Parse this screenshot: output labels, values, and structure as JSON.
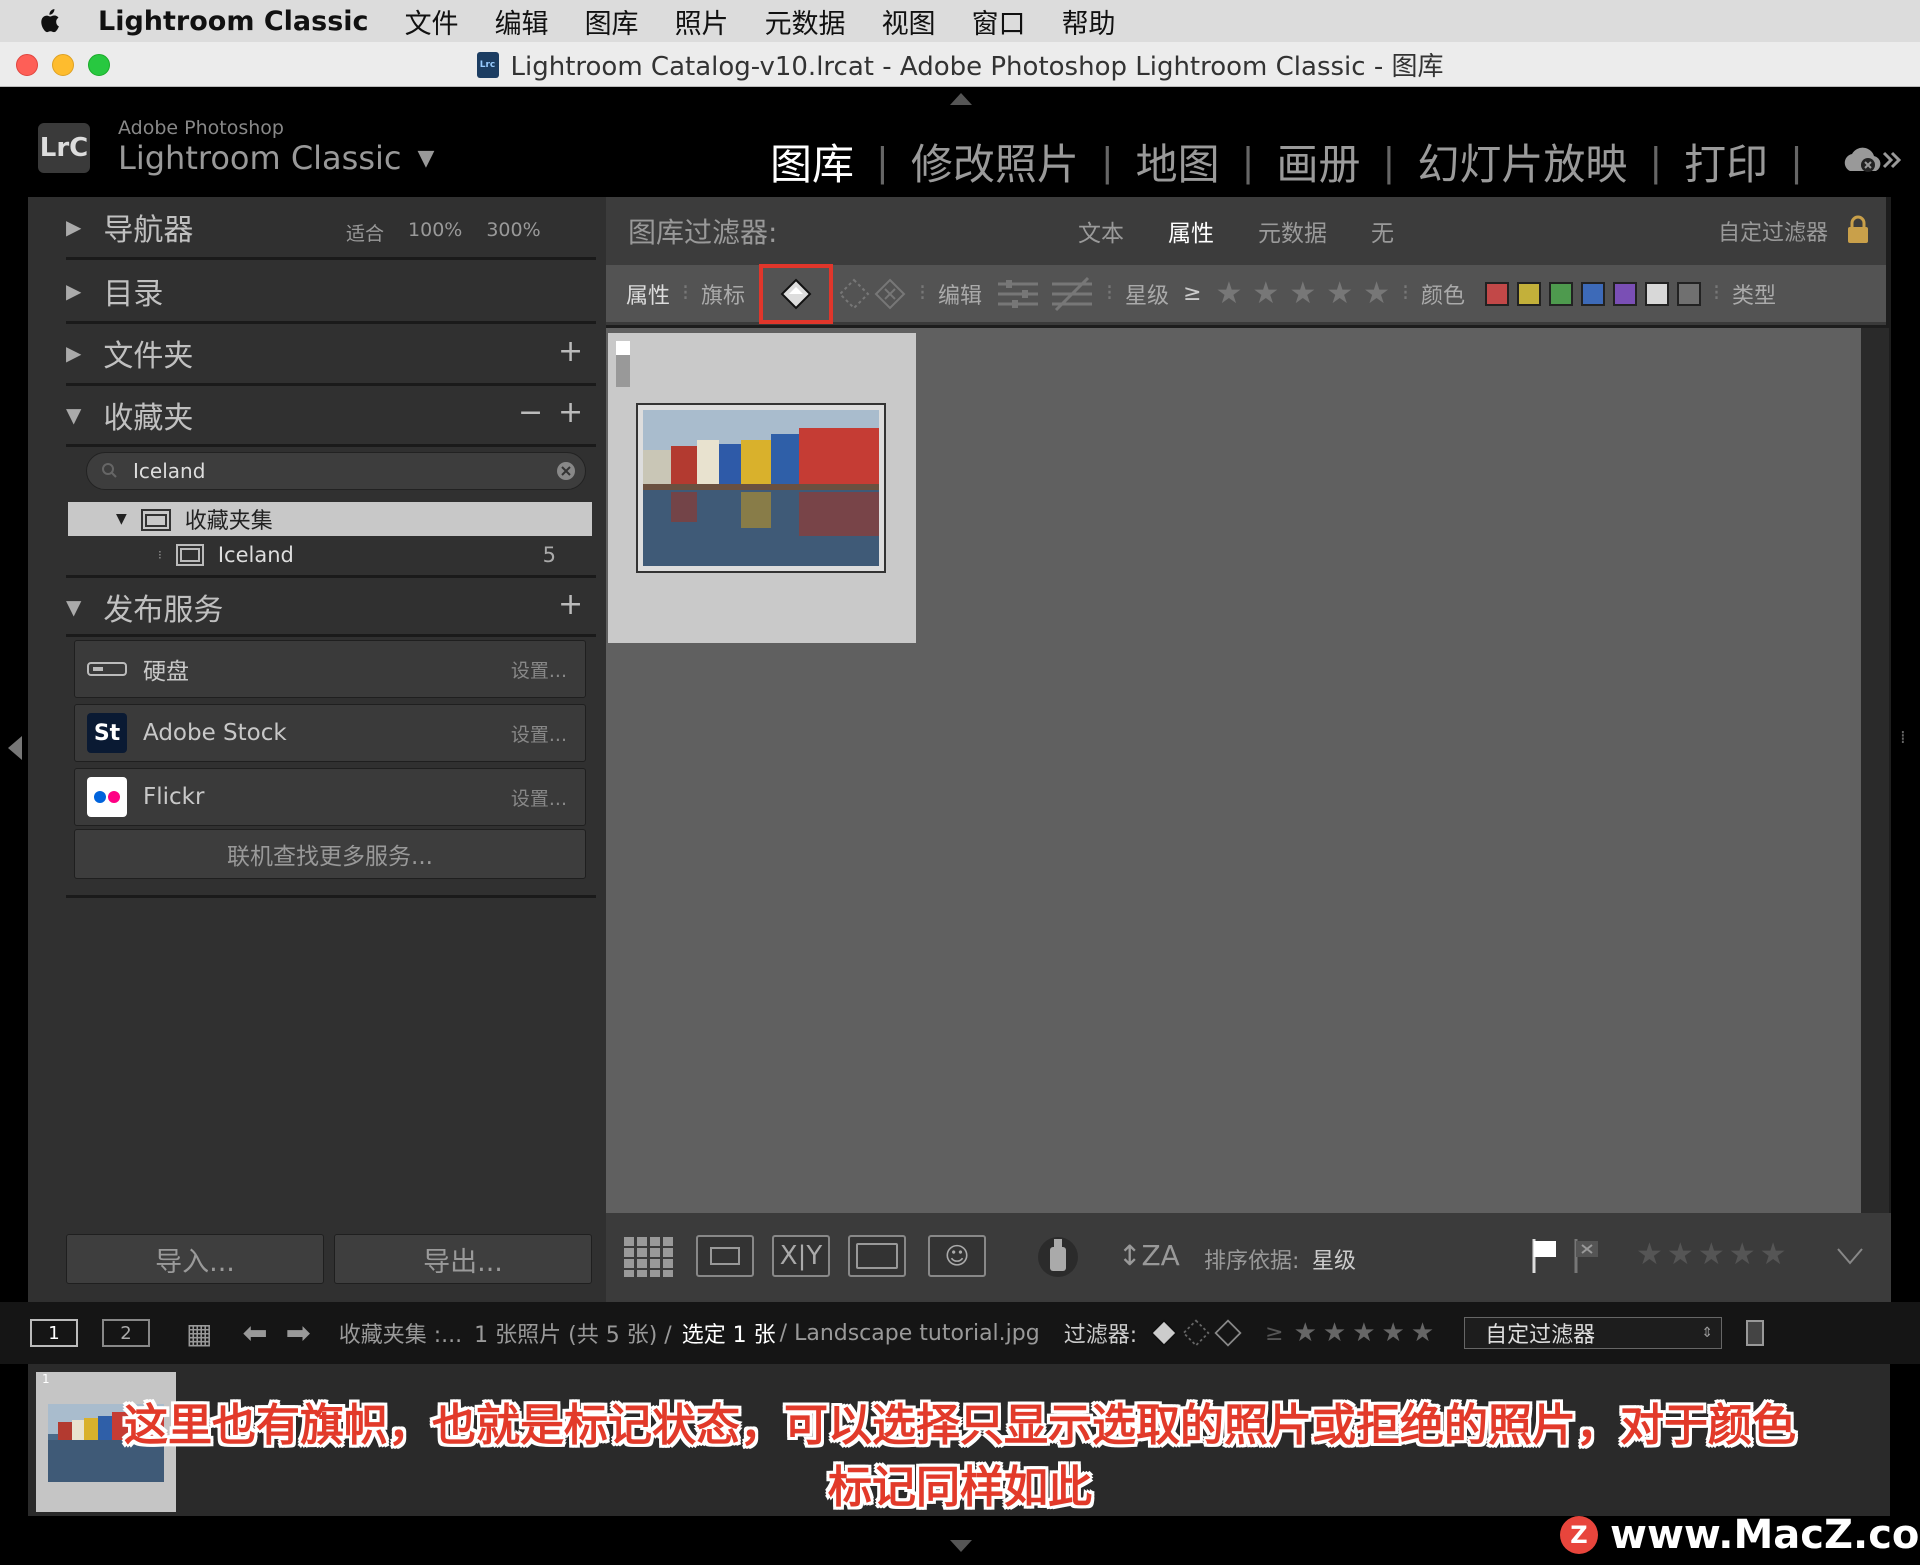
{
  "menubar": {
    "app_name": "Lightroom Classic",
    "items": [
      "文件",
      "编辑",
      "图库",
      "照片",
      "元数据",
      "视图",
      "窗口",
      "帮助"
    ]
  },
  "window": {
    "title": "Lightroom Catalog-v10.lrcat - Adobe Photoshop Lightroom Classic - 图库",
    "doc_icon_text": "Lrc"
  },
  "header": {
    "logo": "LrC",
    "brand_small": "Adobe Photoshop",
    "brand_large": "Lightroom Classic",
    "modules": [
      {
        "label": "图库",
        "active": true
      },
      {
        "label": "修改照片",
        "active": false
      },
      {
        "label": "地图",
        "active": false
      },
      {
        "label": "画册",
        "active": false
      },
      {
        "label": "幻灯片放映",
        "active": false
      },
      {
        "label": "打印",
        "active": false
      }
    ]
  },
  "left_panel": {
    "navigator": {
      "label": "导航器",
      "fit": "适合",
      "zoom1": "100%",
      "zoom2": "300%"
    },
    "catalog": {
      "label": "目录"
    },
    "folders": {
      "label": "文件夹"
    },
    "collections": {
      "label": "收藏夹",
      "search_value": "Iceland",
      "set_label": "收藏夹集",
      "item_label": "Iceland",
      "item_count": "5"
    },
    "publish": {
      "label": "发布服务",
      "services": [
        {
          "name": "硬盘",
          "setup": "设置..."
        },
        {
          "name": "Adobe Stock",
          "setup": "设置..."
        },
        {
          "name": "Flickr",
          "setup": "设置..."
        }
      ],
      "more": "联机查找更多服务..."
    },
    "import_label": "导入...",
    "export_label": "导出..."
  },
  "filter_bar": {
    "title": "图库过滤器:",
    "tabs": [
      {
        "label": "文本",
        "active": false
      },
      {
        "label": "属性",
        "active": true
      },
      {
        "label": "元数据",
        "active": false
      },
      {
        "label": "无",
        "active": false
      }
    ],
    "custom": "自定过滤器",
    "attr_label": "属性",
    "flag_label": "旗标",
    "edit_label": "编辑",
    "rating_label": "星级",
    "rating_op": "≥",
    "color_label": "颜色",
    "type_label": "类型",
    "color_swatches": [
      "#c24848",
      "#c3b03a",
      "#4e9a4e",
      "#3d6ab8",
      "#7a4fb5",
      "#d8d8d8",
      "#707070"
    ]
  },
  "toolbar": {
    "sort_label": "排序依据:",
    "sort_value": "星级"
  },
  "filmstrip_bar": {
    "screen1": "1",
    "screen2": "2",
    "path": "收藏夹集 :...",
    "count": "1 张照片 (共 5 张) /",
    "selected": "选定 1 张",
    "filename": "/ Landscape tutorial.jpg",
    "filter_label": "过滤器:",
    "rating_op": "≥",
    "custom_filter": "自定过滤器"
  },
  "thumb_index": "1",
  "caption": {
    "line1": "这里也有旗帜，也就是标记状态，可以选择只显示选取的照片或拒绝的照片，对于颜色",
    "line2": "标记同样如此"
  },
  "watermark": "www.MacZ.com",
  "colors": {
    "highlight_red": "#e0362b",
    "accent_text": "#e23a2a"
  }
}
